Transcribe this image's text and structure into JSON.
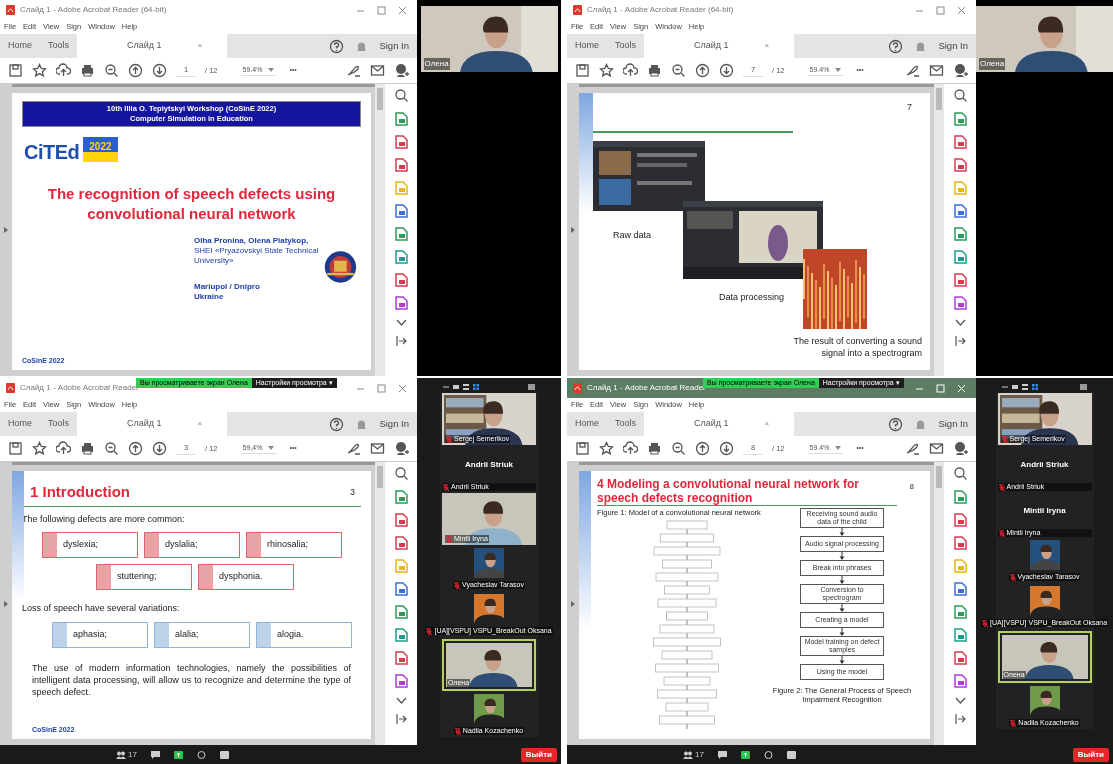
{
  "screens": [
    {
      "window": {
        "title": "Слайд 1 - Adobe Acrobat Reader (64-bit)",
        "active": false
      },
      "menu": [
        "File",
        "Edit",
        "View",
        "Sign",
        "Window",
        "Help"
      ],
      "tabs": [
        {
          "label": "Home",
          "selected": false
        },
        {
          "label": "Tools",
          "selected": false
        },
        {
          "label": "Слайд 1",
          "selected": true,
          "close": "×"
        }
      ],
      "sign_in": "Sign In",
      "page": "1",
      "page_total": "/ 12",
      "zoom": "59.4%",
      "more": "•••",
      "slide": {
        "kind": "title",
        "header": [
          "10th Illia O. Teplytskyi Workshop (CoSinE 2022)",
          "Computer Simulation in Education"
        ],
        "logo": {
          "name": "CiTEd",
          "year": "2022"
        },
        "title": "The recognition of speech defects using convolutional neural network",
        "authors": "Olha Pronina, Olena Piatykop,",
        "affiliation": "SHEI «Pryazovskyi State Technical University»",
        "city": "Mariupol / Dnipro",
        "country": "Ukraine",
        "footer": "CoSinE 2022"
      },
      "panel": {
        "kind": "speaker",
        "name": "Олена"
      }
    },
    {
      "window": {
        "title": "Слайд 1 - Adobe Acrobat Reader (64-bit)",
        "active": false
      },
      "menu": [
        "File",
        "Edit",
        "View",
        "Sign",
        "Window",
        "Help"
      ],
      "tabs": [
        {
          "label": "Home",
          "selected": false
        },
        {
          "label": "Tools",
          "selected": false
        },
        {
          "label": "Слайд 1",
          "selected": true,
          "close": "×"
        }
      ],
      "sign_in": "Sign In",
      "page": "7",
      "page_total": "/ 12",
      "zoom": "59.4%",
      "more": "•••",
      "slide": {
        "kind": "media",
        "number": "7",
        "captions": [
          "Raw data",
          "Data processing",
          "The result of converting a sound signal into a spectrogram"
        ]
      },
      "panel": {
        "kind": "speaker",
        "name": "Олена"
      }
    },
    {
      "window": {
        "title": "Слайд 1 - Adobe Acrobat Reader",
        "active": false
      },
      "banner": {
        "notice": "Вы просматриваете экран Олена",
        "options": "Настройки просмотра ▾"
      },
      "menu": [
        "File",
        "Edit",
        "View",
        "Sign",
        "Window",
        "Help"
      ],
      "tabs": [
        {
          "label": "Home",
          "selected": false
        },
        {
          "label": "Tools",
          "selected": false
        },
        {
          "label": "Слайд 1",
          "selected": true,
          "close": "×"
        }
      ],
      "sign_in": "Sign In",
      "page": "3",
      "page_total": "/ 12",
      "zoom": "59,4%",
      "more": "•••",
      "slide": {
        "kind": "list",
        "title": "1 Introduction",
        "number": "3",
        "groups": [
          {
            "heading": "The following defects are more common:",
            "color": "#d9666b",
            "rows": [
              [
                "dyslexia;",
                "dyslalia;",
                "rhinosalia;"
              ],
              [
                "stuttering;",
                "dysphonia."
              ]
            ]
          },
          {
            "heading": "Loss of speech have several variations:",
            "color": "#8fb5da",
            "rows": [
              [
                "aphasia;",
                "alalia;",
                "alogia."
              ]
            ]
          }
        ],
        "text": "The use of modern information technologies, namely the possibilities of intelligent data processing, will allow us to recognize and determine the type of speech defect.",
        "footer": "CoSinE 2022"
      },
      "panel": {
        "kind": "gallery",
        "tiles": [
          {
            "kind": "video",
            "name": "Sergej Semerikov",
            "muted": true,
            "active": false
          },
          {
            "kind": "name",
            "title": "Andrii Striuk",
            "name": "Andrii Striuk",
            "muted": true
          },
          {
            "kind": "video",
            "name": "Mintii Iryna",
            "muted": true,
            "active": false
          },
          {
            "kind": "avatar",
            "name": "Vyacheslav Tarasov",
            "muted": true
          },
          {
            "kind": "avatar",
            "name": "[UA][VSPU] VSPU_BreakOut Oksana",
            "muted": true
          },
          {
            "kind": "video",
            "name": "Олена",
            "muted": false,
            "active": true
          },
          {
            "kind": "avatar",
            "name": "Nadiia Kozachenko",
            "muted": true
          }
        ],
        "participants": "17",
        "leave": "Выйти"
      }
    },
    {
      "window": {
        "title": "Слайд 1 - Adobe Acrobat Reader",
        "active": true
      },
      "banner": {
        "notice": "Вы просматриваете экран Олена",
        "options": "Настройки просмотра ▾"
      },
      "menu": [
        "File",
        "Edit",
        "View",
        "Sign",
        "Window",
        "Help"
      ],
      "tabs": [
        {
          "label": "Home",
          "selected": false
        },
        {
          "label": "Tools",
          "selected": false
        },
        {
          "label": "Слайд 1",
          "selected": true,
          "close": "×"
        }
      ],
      "sign_in": "Sign In",
      "page": "8",
      "page_total": "/ 12",
      "zoom": "59.4%",
      "more": "•••",
      "slide": {
        "kind": "figures",
        "title": "4 Modeling a convolutional neural network for speech defects recognition",
        "number": "8",
        "figure1": "Figure 1: Model of a convolutional neural network",
        "steps": [
          "Receiving sound audio data of the child",
          "Audio signal processing",
          "Break into phrases",
          "Conversion to spectrogram",
          "Creating a model",
          "Model training on defect samples",
          "Using the model"
        ],
        "figure2": "Figure 2: The General Process of Speech Impairment Recognition"
      },
      "panel": {
        "kind": "gallery",
        "tiles": [
          {
            "kind": "video",
            "name": "Sergej Semerikov",
            "muted": true,
            "active": false
          },
          {
            "kind": "name",
            "title": "Andrii Striuk",
            "name": "Andrii Striuk",
            "muted": true
          },
          {
            "kind": "name",
            "title": "Mintii Iryna",
            "name": "Mintii Iryna",
            "muted": true
          },
          {
            "kind": "avatar",
            "name": "Vyacheslav Tarasov",
            "muted": true
          },
          {
            "kind": "avatar",
            "name": "[UA][VSPU] VSPU_BreakOut Oksana",
            "muted": true
          },
          {
            "kind": "video",
            "name": "Олена",
            "muted": false,
            "active": true
          },
          {
            "kind": "avatar",
            "name": "Nadiia Kozachenko",
            "muted": true
          }
        ],
        "participants": "17",
        "leave": "Выйти"
      }
    }
  ]
}
